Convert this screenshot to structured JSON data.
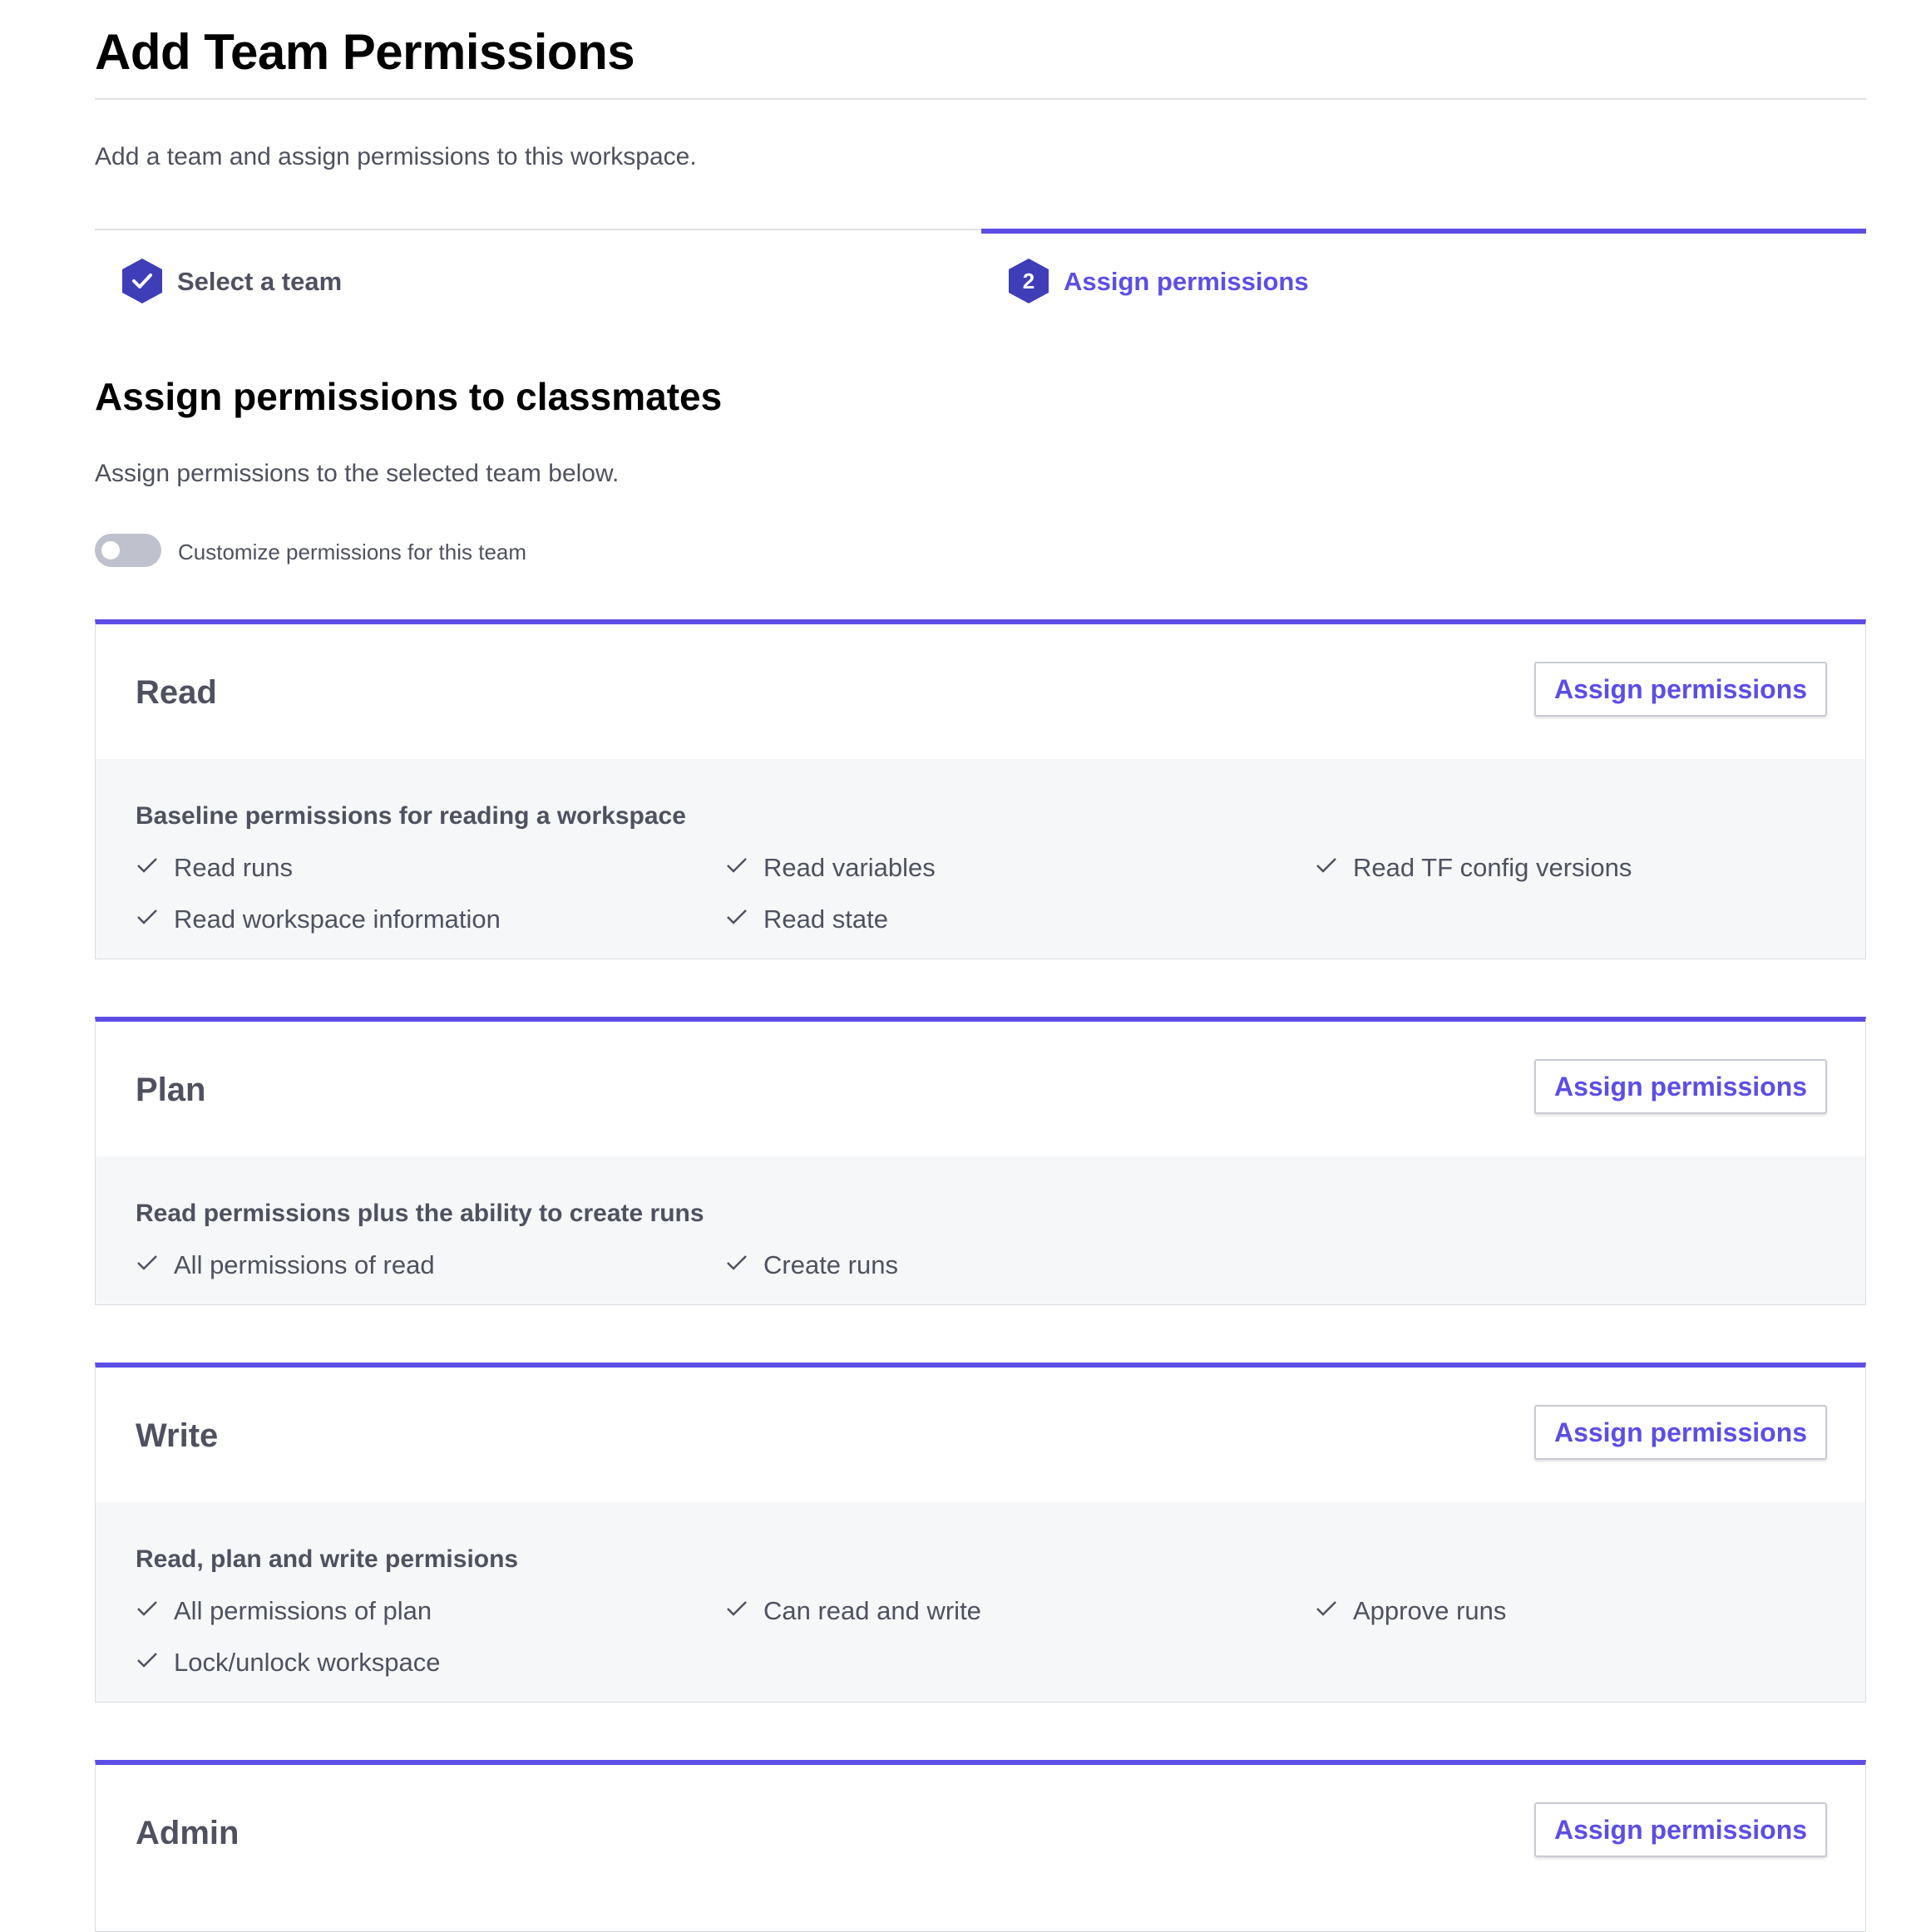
{
  "page": {
    "title": "Add Team Permissions",
    "description": "Add a team and assign permissions to this workspace."
  },
  "steps": [
    {
      "label": "Select a team",
      "state": "completed",
      "icon": "check-icon"
    },
    {
      "label": "Assign permissions",
      "number": "2",
      "state": "active"
    }
  ],
  "section": {
    "title": "Assign permissions to classmates",
    "description": "Assign permissions to the selected team below."
  },
  "toggle": {
    "label": "Customize permissions for this team",
    "on": false
  },
  "cards": [
    {
      "title": "Read",
      "button": "Assign permissions",
      "heading": "Baseline permissions for reading a workspace",
      "items": [
        "Read runs",
        "Read variables",
        "Read TF config versions",
        "Read workspace information",
        "Read state"
      ]
    },
    {
      "title": "Plan",
      "button": "Assign permissions",
      "heading": "Read permissions plus the ability to create runs",
      "items": [
        "All permissions of read",
        "Create runs"
      ]
    },
    {
      "title": "Write",
      "button": "Assign permissions",
      "heading": "Read, plan and write permisions",
      "items": [
        "All permissions of plan",
        "Can read and write",
        "Approve runs",
        "Lock/unlock workspace"
      ]
    },
    {
      "title": "Admin",
      "button": "Assign permissions"
    }
  ],
  "colors": {
    "accent": "#5c4ee5",
    "hex_step": "#3f3eb8",
    "text_muted": "#4f5160",
    "card_body_bg": "#f6f7f9",
    "toggle_off": "#bfc2cc"
  }
}
